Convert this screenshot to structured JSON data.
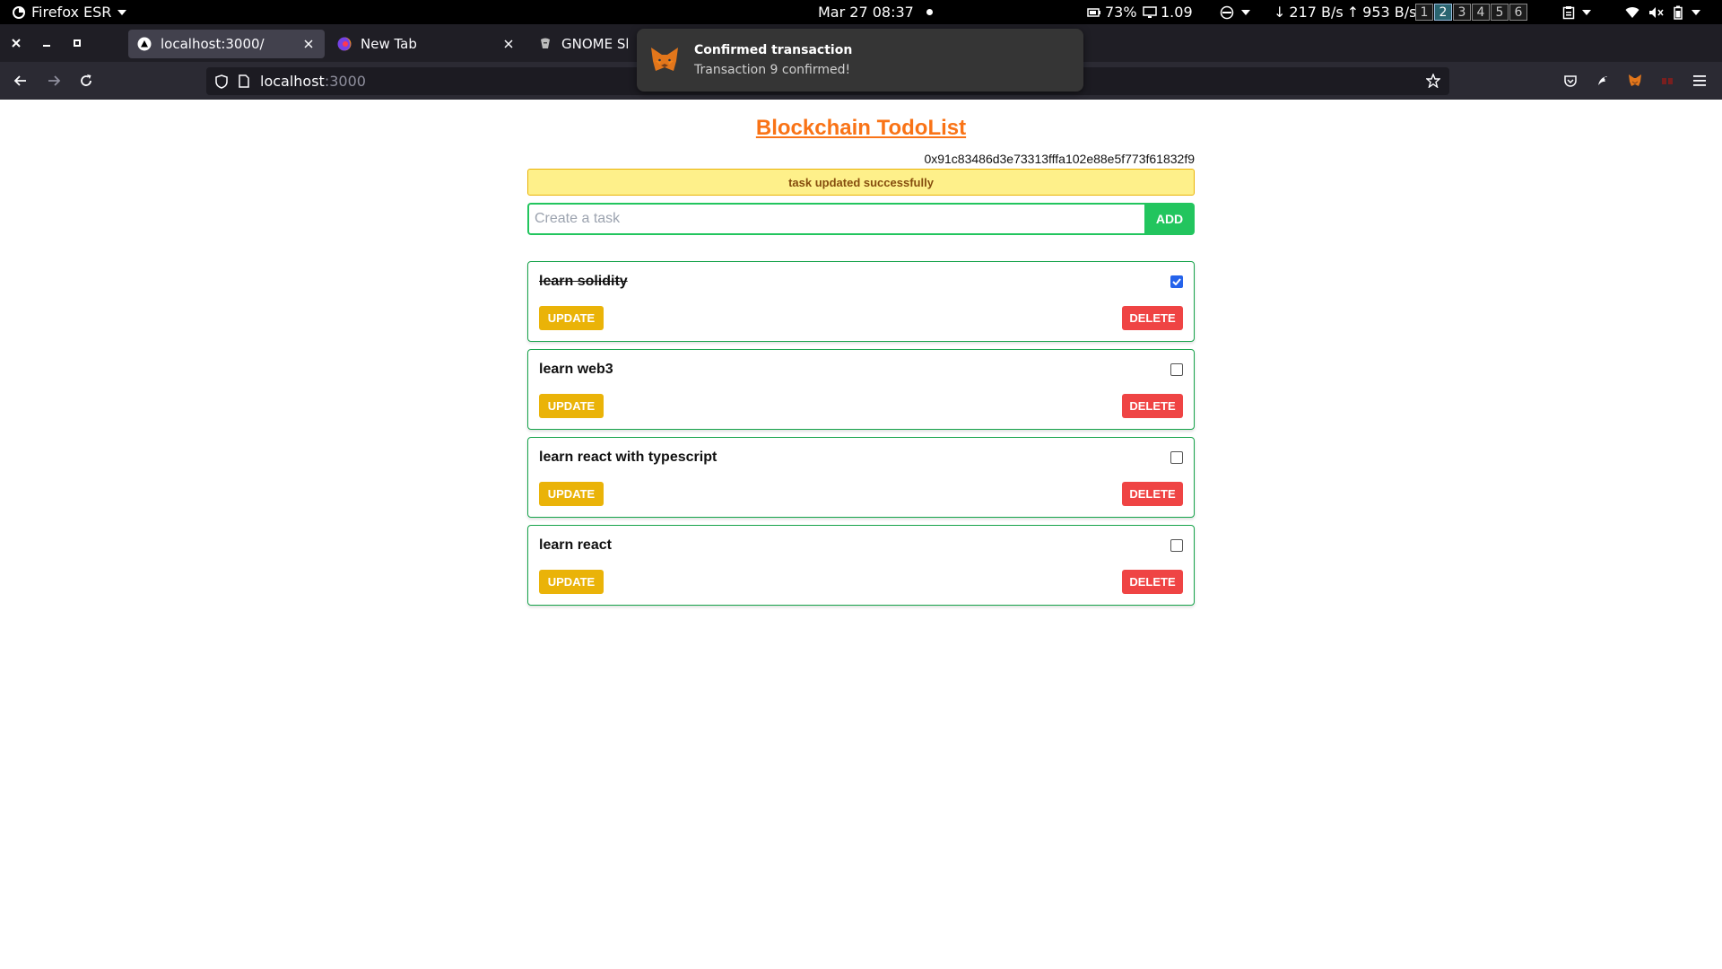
{
  "topbar": {
    "app_name": "Firefox ESR",
    "clock": "Mar 27  08:37",
    "battery": "73%",
    "load": "1.09",
    "net_down": "217 B/s",
    "net_up": "953 B/s",
    "workspaces": [
      "1",
      "2",
      "3",
      "4",
      "5",
      "6"
    ],
    "active_workspace": "2"
  },
  "tabs": [
    {
      "title": "localhost:3000/",
      "active": true,
      "icon": "nextjs-icon"
    },
    {
      "title": "New Tab",
      "active": false,
      "icon": "firefox-icon"
    },
    {
      "title": "GNOME Shel",
      "active": false,
      "icon": "gnome-icon"
    }
  ],
  "navbar": {
    "url_host": "localhost",
    "url_port": ":3000"
  },
  "notification": {
    "title": "Confirmed transaction",
    "body": "Transaction 9 confirmed!",
    "icon": "metamask-fox-icon"
  },
  "app": {
    "title": "Blockchain TodoList",
    "account": "0x91c83486d3e73313fffa102e88e5f773f61832f9",
    "alert": "task updated successfully",
    "create": {
      "placeholder": "Create a task",
      "value": "",
      "add_label": "ADD"
    },
    "update_label": "UPDATE",
    "delete_label": "DELETE",
    "tasks": [
      {
        "text": "learn solidity",
        "completed": true
      },
      {
        "text": "learn web3",
        "completed": false
      },
      {
        "text": "learn react with typescript",
        "completed": false
      },
      {
        "text": "learn react",
        "completed": false
      }
    ]
  },
  "colors": {
    "title_orange": "#f97316",
    "task_border_green": "#16a34a",
    "add_green": "#22c55e",
    "update_yellow": "#eab308",
    "delete_red": "#ef4444",
    "alert_bg": "#fef08a",
    "checkbox_blue": "#2563eb"
  }
}
